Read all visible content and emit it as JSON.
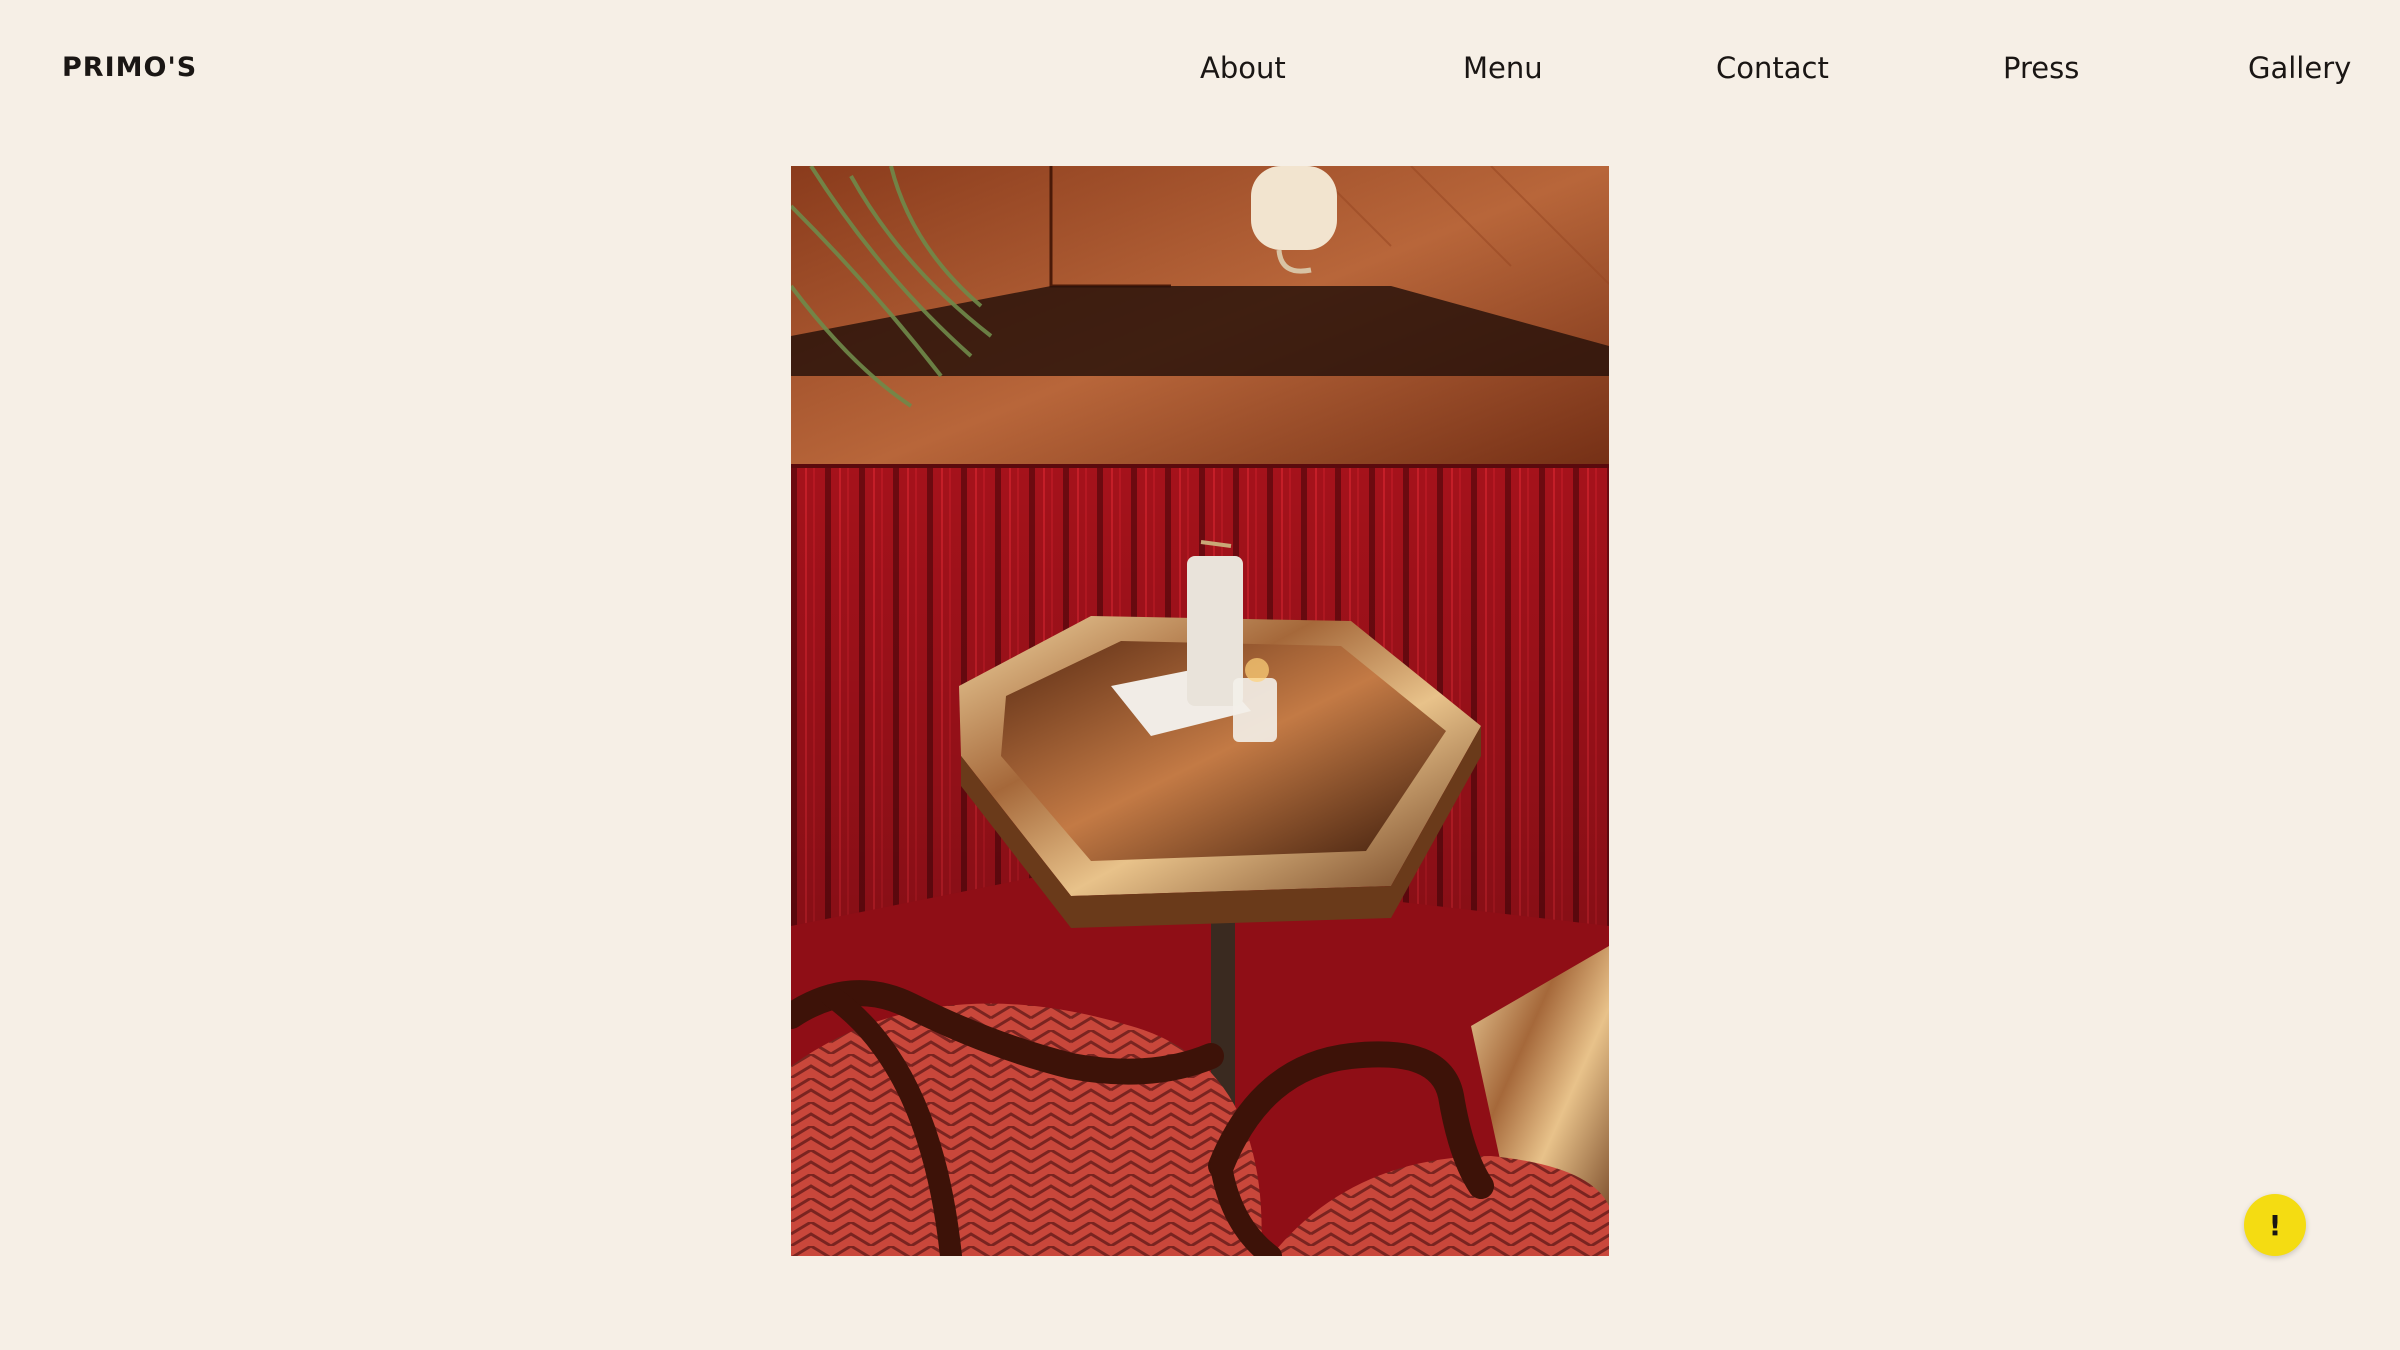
{
  "brand": {
    "logo_text": "PRIMO'S"
  },
  "nav": {
    "items": [
      {
        "label": "About"
      },
      {
        "label": "Menu"
      },
      {
        "label": "Contact"
      },
      {
        "label": "Press"
      },
      {
        "label": "Gallery"
      }
    ]
  },
  "gallery": {
    "image_alt": ""
  },
  "help": {
    "label": "!",
    "icon": "alert-icon"
  },
  "colors": {
    "background": "#f6efe6",
    "text": "#1a1614",
    "help_button": "#f4dc12",
    "banquette_red": "#a5121b"
  }
}
